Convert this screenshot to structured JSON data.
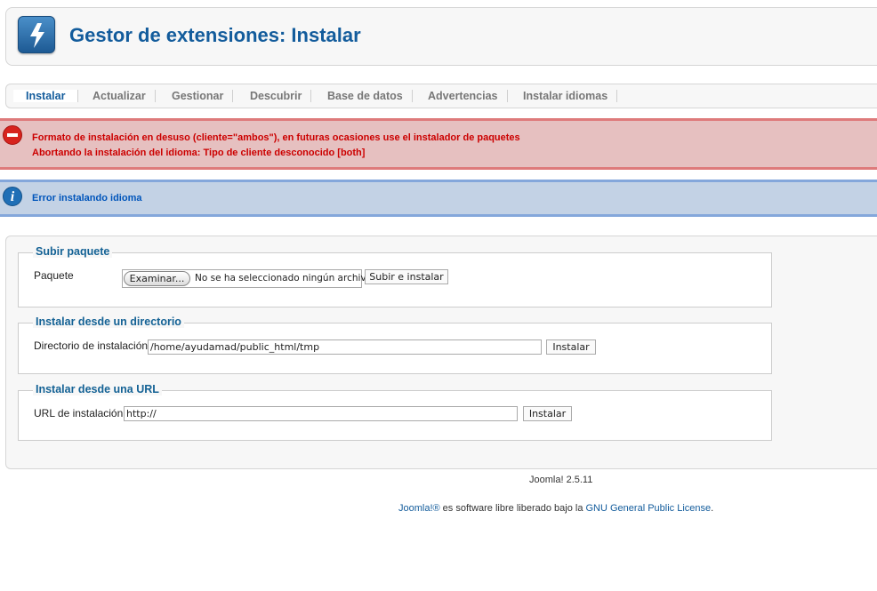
{
  "header": {
    "title": "Gestor de extensiones: Instalar",
    "icon": "lightning-icon"
  },
  "tabs": [
    {
      "label": "Instalar",
      "active": true
    },
    {
      "label": "Actualizar",
      "active": false
    },
    {
      "label": "Gestionar",
      "active": false
    },
    {
      "label": "Descubrir",
      "active": false
    },
    {
      "label": "Base de datos",
      "active": false
    },
    {
      "label": "Advertencias",
      "active": false
    },
    {
      "label": "Instalar idiomas",
      "active": false
    }
  ],
  "messages": {
    "error": {
      "icon": "no-entry-icon",
      "lines": [
        "Formato de instalación en desuso (cliente=\"ambos\"), en futuras ocasiones use el instalador de paquetes",
        "Abortando la instalación del idioma: Tipo de cliente desconocido [both]"
      ]
    },
    "info": {
      "icon": "info-icon",
      "text": "Error instalando idioma"
    }
  },
  "upload": {
    "legend": "Subir paquete",
    "label": "Paquete",
    "browse_label": "Examinar...",
    "file_status": "No se ha seleccionado ningún archivo.",
    "submit_label": "Subir e instalar"
  },
  "directory": {
    "legend": "Instalar desde un directorio",
    "label": "Directorio de instalación",
    "value": "/home/ayudamad/public_html/tmp",
    "submit_label": "Instalar"
  },
  "url": {
    "legend": "Instalar desde una URL",
    "label": "URL de instalación",
    "value": "http://",
    "submit_label": "Instalar"
  },
  "footer": {
    "version": "Joomla! 2.5.11",
    "license_link": "Joomla!®",
    "license_text": " es software libre liberado bajo la ",
    "license_name": "GNU General Public License",
    "license_end": "."
  },
  "colors": {
    "title": "#135c9c",
    "error_bg": "#e6c0c0",
    "error_text": "#cc0000",
    "info_bg": "#c3d2e5",
    "info_text": "#0055bb"
  }
}
